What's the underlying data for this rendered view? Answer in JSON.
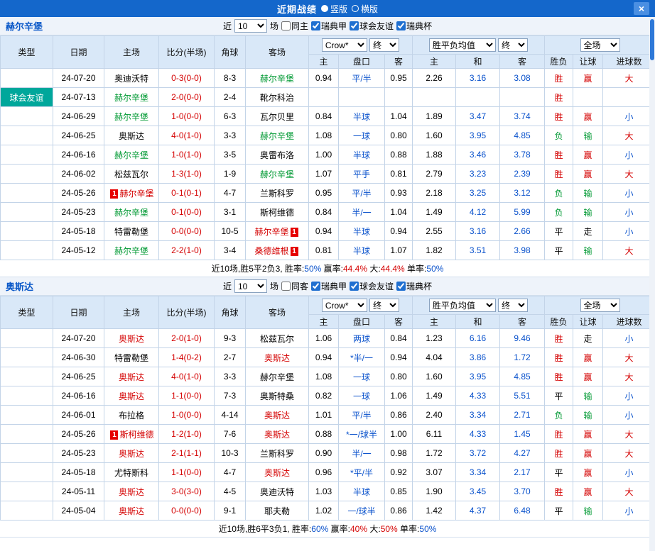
{
  "topbar": {
    "title": "近期战绩",
    "portrait_label": "竖版",
    "landscape_label": "横版",
    "close_label": "×"
  },
  "filters": {
    "near": "近",
    "count": "10",
    "games": "场",
    "leagues": [
      "瑞典甲",
      "球会友谊",
      "瑞典杯"
    ]
  },
  "table_header": {
    "type": "类型",
    "date": "日期",
    "home": "主场",
    "score": "比分(半场)",
    "corner": "角球",
    "away": "客场",
    "company": "Crow*",
    "final": "终",
    "avg": "胜平负均值",
    "full": "全场",
    "h": "主",
    "handicap": "盘口",
    "a": "客",
    "avg_h": "主",
    "avg_d": "和",
    "avg_a": "客",
    "wdl": "胜负",
    "let_goal": "让球",
    "goals": "进球数"
  },
  "colors": {
    "topbar_blue": "#1467cb",
    "league_badge_blue": "#1b5aa8",
    "friendly_badge_teal": "#00a79b",
    "win_red": "#d40000",
    "lose_green": "#009933",
    "odds_blue": "#0a52cc"
  },
  "sections": [
    {
      "team": "赫尔辛堡",
      "same_filter": "同主",
      "rows": [
        {
          "league": "瑞典甲",
          "friendly": false,
          "date": "24-07-20",
          "home": {
            "name": "奥迪沃特",
            "color": "black"
          },
          "score": "0-3(0-0)",
          "corner": "8-3",
          "away": {
            "name": "赫尔辛堡",
            "color": "green"
          },
          "odds": [
            "0.94",
            "平/半",
            "0.95",
            "2.26",
            "3.16",
            "3.08"
          ],
          "results": [
            [
              "胜",
              "red"
            ],
            [
              "赢",
              "red"
            ],
            [
              "大",
              "red"
            ]
          ]
        },
        {
          "league": "球会友谊",
          "friendly": true,
          "date": "24-07-13",
          "home": {
            "name": "赫尔辛堡",
            "color": "green"
          },
          "score": "2-0(0-0)",
          "corner": "2-4",
          "away": {
            "name": "靴尔科治",
            "color": "black"
          },
          "odds": [
            "",
            "",
            "",
            "",
            "",
            ""
          ],
          "results": [
            [
              "胜",
              "red"
            ],
            [
              "",
              ""
            ],
            [
              "",
              ""
            ]
          ]
        },
        {
          "league": "瑞典甲",
          "friendly": false,
          "date": "24-06-29",
          "home": {
            "name": "赫尔辛堡",
            "color": "green"
          },
          "score": "1-0(0-0)",
          "corner": "6-3",
          "away": {
            "name": "瓦尔贝里",
            "color": "black"
          },
          "odds": [
            "0.84",
            "半球",
            "1.04",
            "1.89",
            "3.47",
            "3.74"
          ],
          "results": [
            [
              "胜",
              "red"
            ],
            [
              "赢",
              "red"
            ],
            [
              "小",
              "blue"
            ]
          ]
        },
        {
          "league": "瑞典甲",
          "friendly": false,
          "date": "24-06-25",
          "home": {
            "name": "奥斯达",
            "color": "black"
          },
          "score": "4-0(1-0)",
          "corner": "3-3",
          "away": {
            "name": "赫尔辛堡",
            "color": "green"
          },
          "odds": [
            "1.08",
            "一球",
            "0.80",
            "1.60",
            "3.95",
            "4.85"
          ],
          "results": [
            [
              "负",
              "green"
            ],
            [
              "输",
              "green"
            ],
            [
              "大",
              "red"
            ]
          ]
        },
        {
          "league": "瑞典甲",
          "friendly": false,
          "date": "24-06-16",
          "home": {
            "name": "赫尔辛堡",
            "color": "green"
          },
          "score": "1-0(1-0)",
          "corner": "3-5",
          "away": {
            "name": "奥雷布洛",
            "color": "black"
          },
          "odds": [
            "1.00",
            "半球",
            "0.88",
            "1.88",
            "3.46",
            "3.78"
          ],
          "results": [
            [
              "胜",
              "red"
            ],
            [
              "赢",
              "red"
            ],
            [
              "小",
              "blue"
            ]
          ]
        },
        {
          "league": "瑞典甲",
          "friendly": false,
          "date": "24-06-02",
          "home": {
            "name": "松兹瓦尔",
            "color": "black"
          },
          "score": "1-3(1-0)",
          "corner": "1-9",
          "away": {
            "name": "赫尔辛堡",
            "color": "green"
          },
          "odds": [
            "1.07",
            "平手",
            "0.81",
            "2.79",
            "3.23",
            "2.39"
          ],
          "results": [
            [
              "胜",
              "red"
            ],
            [
              "赢",
              "red"
            ],
            [
              "大",
              "red"
            ]
          ]
        },
        {
          "league": "瑞典甲",
          "friendly": false,
          "date": "24-05-26",
          "home": {
            "name": "赫尔辛堡",
            "color": "red",
            "badge": "1",
            "badge_pos": "before"
          },
          "score": "0-1(0-1)",
          "corner": "4-7",
          "away": {
            "name": "兰斯科罗",
            "color": "black"
          },
          "odds": [
            "0.95",
            "平/半",
            "0.93",
            "2.18",
            "3.25",
            "3.12"
          ],
          "results": [
            [
              "负",
              "green"
            ],
            [
              "输",
              "green"
            ],
            [
              "小",
              "blue"
            ]
          ]
        },
        {
          "league": "瑞典甲",
          "friendly": false,
          "date": "24-05-23",
          "home": {
            "name": "赫尔辛堡",
            "color": "green"
          },
          "score": "0-1(0-0)",
          "corner": "3-1",
          "away": {
            "name": "斯柯维德",
            "color": "black"
          },
          "odds": [
            "0.84",
            "半/一",
            "1.04",
            "1.49",
            "4.12",
            "5.99"
          ],
          "results": [
            [
              "负",
              "green"
            ],
            [
              "输",
              "green"
            ],
            [
              "小",
              "blue"
            ]
          ]
        },
        {
          "league": "瑞典甲",
          "friendly": false,
          "date": "24-05-18",
          "home": {
            "name": "特雷勒堡",
            "color": "black"
          },
          "score": "0-0(0-0)",
          "corner": "10-5",
          "away": {
            "name": "赫尔辛堡",
            "color": "red",
            "badge": "1",
            "badge_pos": "after"
          },
          "odds": [
            "0.94",
            "半球",
            "0.94",
            "2.55",
            "3.16",
            "2.66"
          ],
          "results": [
            [
              "平",
              "black"
            ],
            [
              "走",
              "black"
            ],
            [
              "小",
              "blue"
            ]
          ]
        },
        {
          "league": "瑞典甲",
          "friendly": false,
          "date": "24-05-12",
          "home": {
            "name": "赫尔辛堡",
            "color": "green"
          },
          "score": "2-2(1-0)",
          "corner": "3-4",
          "away": {
            "name": "桑德维根",
            "color": "red",
            "badge": "1",
            "badge_pos": "after"
          },
          "odds": [
            "0.81",
            "半球",
            "1.07",
            "1.82",
            "3.51",
            "3.98"
          ],
          "results": [
            [
              "平",
              "black"
            ],
            [
              "输",
              "green"
            ],
            [
              "大",
              "red"
            ]
          ]
        }
      ],
      "summary": [
        {
          "text": "近10场,胜5平2负3, 胜率:",
          "color": "black"
        },
        {
          "text": "50%",
          "color": "blue"
        },
        {
          "text": " 赢率:",
          "color": "black"
        },
        {
          "text": "44.4%",
          "color": "red"
        },
        {
          "text": " 大:",
          "color": "black"
        },
        {
          "text": "44.4%",
          "color": "red"
        },
        {
          "text": " 单率:",
          "color": "black"
        },
        {
          "text": "50%",
          "color": "blue"
        }
      ]
    },
    {
      "team": "奥斯达",
      "same_filter": "同客",
      "rows": [
        {
          "league": "瑞典甲",
          "friendly": false,
          "date": "24-07-20",
          "home": {
            "name": "奥斯达",
            "color": "red"
          },
          "score": "2-0(1-0)",
          "corner": "9-3",
          "away": {
            "name": "松兹瓦尔",
            "color": "black"
          },
          "odds": [
            "1.06",
            "两球",
            "0.84",
            "1.23",
            "6.16",
            "9.46"
          ],
          "results": [
            [
              "胜",
              "red"
            ],
            [
              "走",
              "black"
            ],
            [
              "小",
              "blue"
            ]
          ]
        },
        {
          "league": "瑞典甲",
          "friendly": false,
          "date": "24-06-30",
          "home": {
            "name": "特雷勒堡",
            "color": "black"
          },
          "score": "1-4(0-2)",
          "corner": "2-7",
          "away": {
            "name": "奥斯达",
            "color": "red"
          },
          "odds": [
            "0.94",
            "*半/一",
            "0.94",
            "4.04",
            "3.86",
            "1.72"
          ],
          "results": [
            [
              "胜",
              "red"
            ],
            [
              "赢",
              "red"
            ],
            [
              "大",
              "red"
            ]
          ]
        },
        {
          "league": "瑞典甲",
          "friendly": false,
          "date": "24-06-25",
          "home": {
            "name": "奥斯达",
            "color": "red"
          },
          "score": "4-0(1-0)",
          "corner": "3-3",
          "away": {
            "name": "赫尔辛堡",
            "color": "black"
          },
          "odds": [
            "1.08",
            "一球",
            "0.80",
            "1.60",
            "3.95",
            "4.85"
          ],
          "results": [
            [
              "胜",
              "red"
            ],
            [
              "赢",
              "red"
            ],
            [
              "大",
              "red"
            ]
          ]
        },
        {
          "league": "瑞典甲",
          "friendly": false,
          "date": "24-06-16",
          "home": {
            "name": "奥斯达",
            "color": "red"
          },
          "score": "1-1(0-0)",
          "corner": "7-3",
          "away": {
            "name": "奥斯特桑",
            "color": "black"
          },
          "odds": [
            "0.82",
            "一球",
            "1.06",
            "1.49",
            "4.33",
            "5.51"
          ],
          "results": [
            [
              "平",
              "black"
            ],
            [
              "输",
              "green"
            ],
            [
              "小",
              "blue"
            ]
          ]
        },
        {
          "league": "瑞典甲",
          "friendly": false,
          "date": "24-06-01",
          "home": {
            "name": "布拉格",
            "color": "black"
          },
          "score": "1-0(0-0)",
          "corner": "4-14",
          "away": {
            "name": "奥斯达",
            "color": "red"
          },
          "odds": [
            "1.01",
            "平/半",
            "0.86",
            "2.40",
            "3.34",
            "2.71"
          ],
          "results": [
            [
              "负",
              "green"
            ],
            [
              "输",
              "green"
            ],
            [
              "小",
              "blue"
            ]
          ]
        },
        {
          "league": "瑞典甲",
          "friendly": false,
          "date": "24-05-26",
          "home": {
            "name": "斯柯维德",
            "color": "red",
            "badge": "1",
            "badge_pos": "before"
          },
          "score": "1-2(1-0)",
          "corner": "7-6",
          "away": {
            "name": "奥斯达",
            "color": "red"
          },
          "odds": [
            "0.88",
            "*一/球半",
            "1.00",
            "6.11",
            "4.33",
            "1.45"
          ],
          "results": [
            [
              "胜",
              "red"
            ],
            [
              "赢",
              "red"
            ],
            [
              "大",
              "red"
            ]
          ]
        },
        {
          "league": "瑞典甲",
          "friendly": false,
          "date": "24-05-23",
          "home": {
            "name": "奥斯达",
            "color": "red"
          },
          "score": "2-1(1-1)",
          "corner": "10-3",
          "away": {
            "name": "兰斯科罗",
            "color": "black"
          },
          "odds": [
            "0.90",
            "半/一",
            "0.98",
            "1.72",
            "3.72",
            "4.27"
          ],
          "results": [
            [
              "胜",
              "red"
            ],
            [
              "赢",
              "red"
            ],
            [
              "大",
              "red"
            ]
          ]
        },
        {
          "league": "瑞典甲",
          "friendly": false,
          "date": "24-05-18",
          "home": {
            "name": "尤特斯科",
            "color": "black"
          },
          "score": "1-1(0-0)",
          "corner": "4-7",
          "away": {
            "name": "奥斯达",
            "color": "red"
          },
          "odds": [
            "0.96",
            "*平/半",
            "0.92",
            "3.07",
            "3.34",
            "2.17"
          ],
          "results": [
            [
              "平",
              "black"
            ],
            [
              "赢",
              "red"
            ],
            [
              "小",
              "blue"
            ]
          ]
        },
        {
          "league": "瑞典甲",
          "friendly": false,
          "date": "24-05-11",
          "home": {
            "name": "奥斯达",
            "color": "red"
          },
          "score": "3-0(3-0)",
          "corner": "4-5",
          "away": {
            "name": "奥迪沃特",
            "color": "black"
          },
          "odds": [
            "1.03",
            "半球",
            "0.85",
            "1.90",
            "3.45",
            "3.70"
          ],
          "results": [
            [
              "胜",
              "red"
            ],
            [
              "赢",
              "red"
            ],
            [
              "大",
              "red"
            ]
          ]
        },
        {
          "league": "瑞典甲",
          "friendly": false,
          "date": "24-05-04",
          "home": {
            "name": "奥斯达",
            "color": "red"
          },
          "score": "0-0(0-0)",
          "corner": "9-1",
          "away": {
            "name": "耶夫勒",
            "color": "black"
          },
          "odds": [
            "1.02",
            "一/球半",
            "0.86",
            "1.42",
            "4.37",
            "6.48"
          ],
          "results": [
            [
              "平",
              "black"
            ],
            [
              "输",
              "green"
            ],
            [
              "小",
              "blue"
            ]
          ]
        }
      ],
      "summary": [
        {
          "text": "近10场,胜6平3负1, 胜率:",
          "color": "black"
        },
        {
          "text": "60%",
          "color": "blue"
        },
        {
          "text": " 赢率:",
          "color": "black"
        },
        {
          "text": "40%",
          "color": "red"
        },
        {
          "text": " 大:",
          "color": "black"
        },
        {
          "text": "50%",
          "color": "red"
        },
        {
          "text": " 单率:",
          "color": "black"
        },
        {
          "text": "50%",
          "color": "blue"
        }
      ]
    }
  ]
}
